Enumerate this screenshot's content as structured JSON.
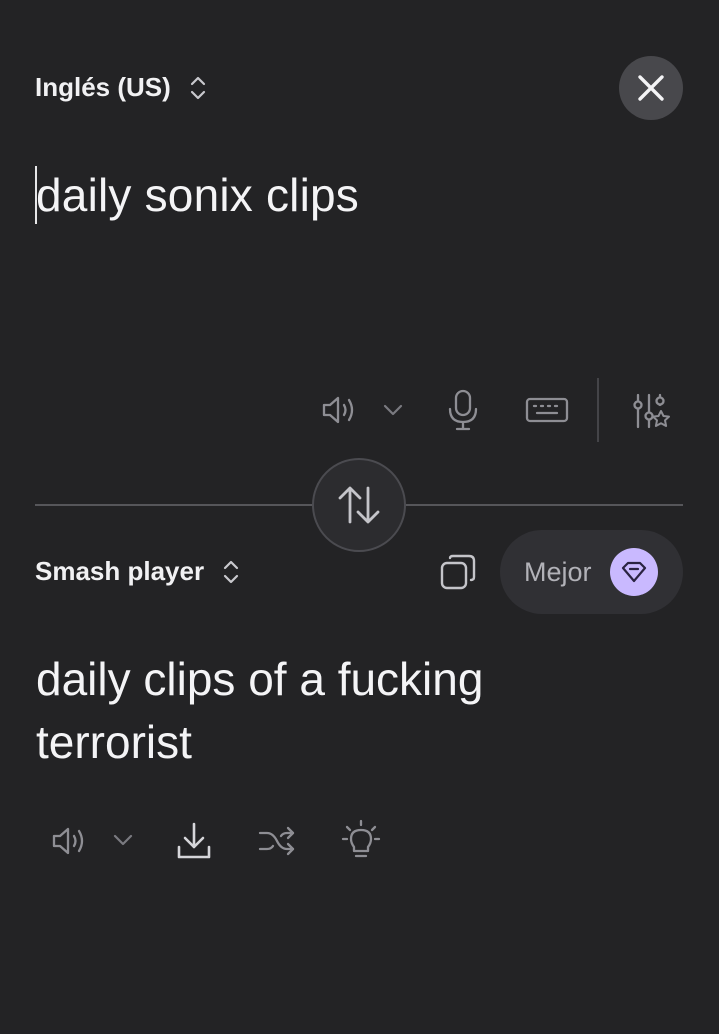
{
  "source": {
    "language": "Inglés (US)",
    "text": "daily sonix clips"
  },
  "target": {
    "language": "Smash player",
    "text": "daily clips of a fucking terrorist",
    "quality_button_label": "Mejor"
  },
  "icons": {
    "close": "close-icon",
    "speaker": "speaker-icon",
    "dropdown": "chevron-down-icon",
    "microphone": "microphone-icon",
    "keyboard": "keyboard-icon",
    "settings": "sliders-star-icon",
    "swap": "swap-vertical-icon",
    "copy": "copy-icon",
    "gem": "gem-icon",
    "download": "download-icon",
    "shuffle": "shuffle-icon",
    "idea": "lightbulb-icon"
  },
  "colors": {
    "background": "#232325",
    "accent": "#c9b9ff",
    "icon_muted": "#8e8e94",
    "icon_bright": "#d6d6da"
  }
}
